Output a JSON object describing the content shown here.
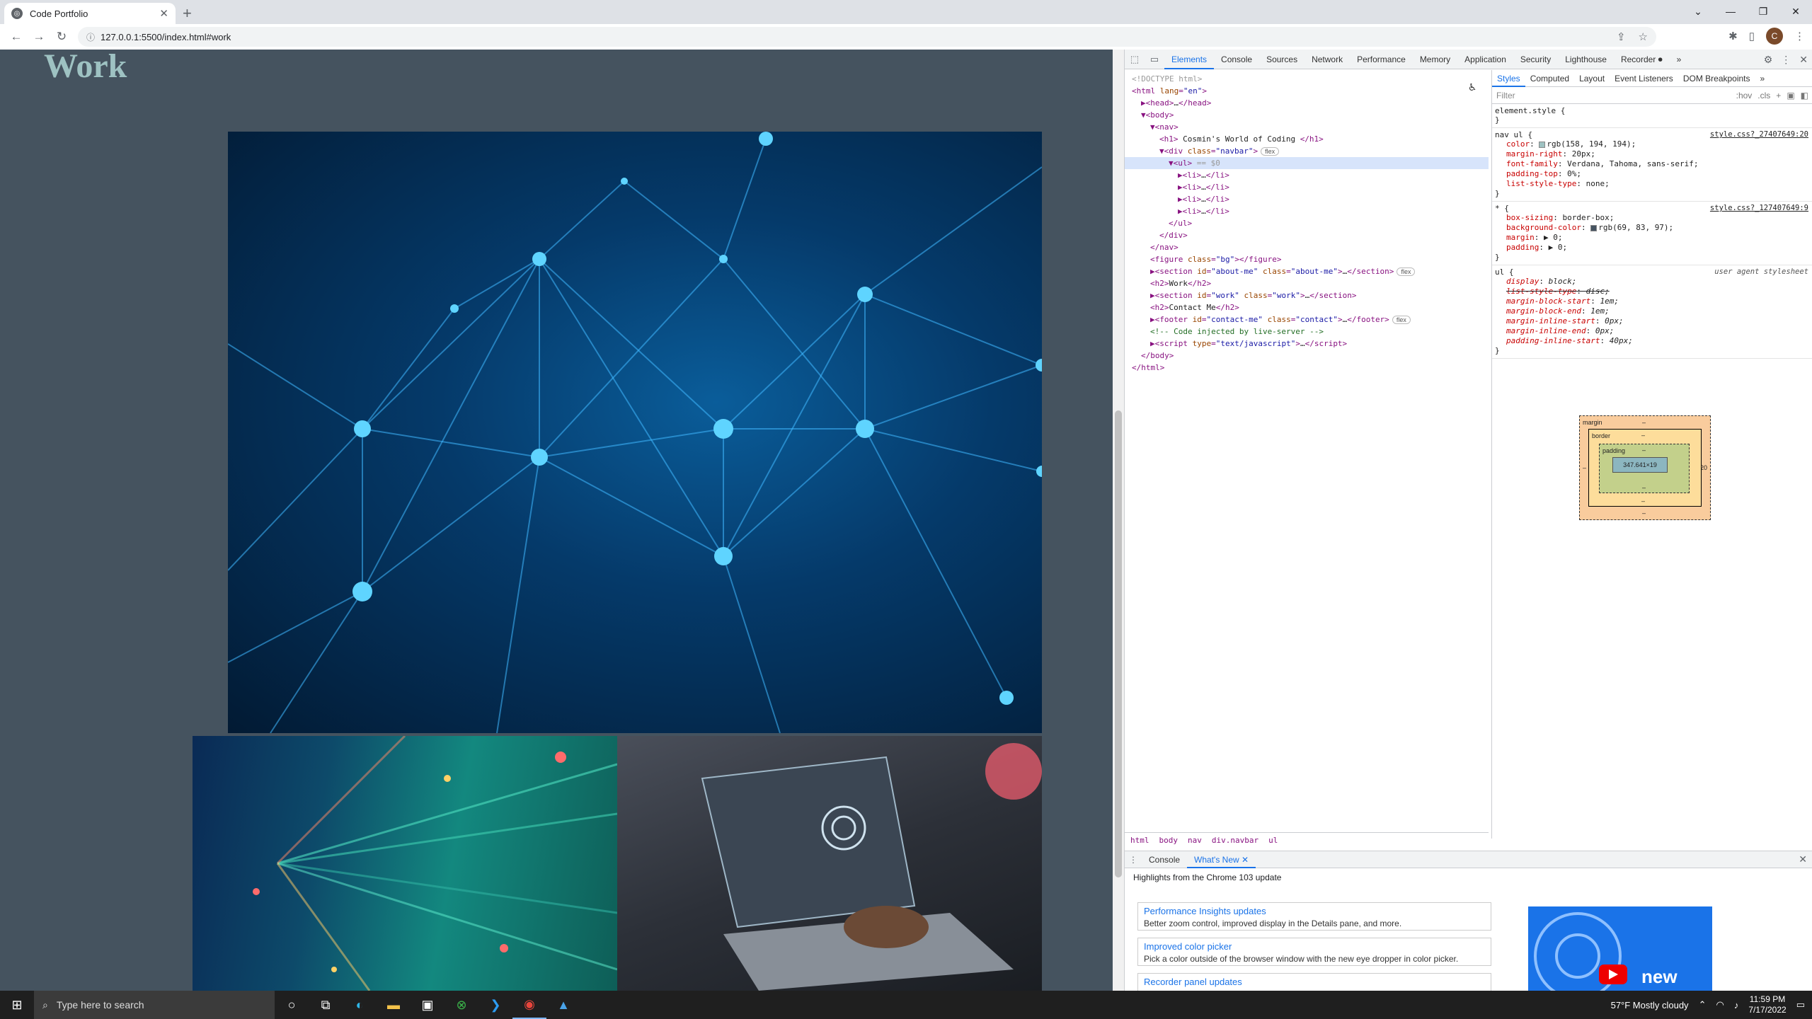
{
  "browser": {
    "tab_title": "Code Portfolio",
    "url": "127.0.0.1:5500/index.html#work",
    "profile_initial": "C"
  },
  "page": {
    "heading": "Work"
  },
  "devtools": {
    "tabs": [
      "Elements",
      "Console",
      "Sources",
      "Network",
      "Performance",
      "Memory",
      "Application",
      "Security",
      "Lighthouse",
      "Recorder ⏺",
      "»"
    ],
    "dom_lines": [
      {
        "indent": 0,
        "html": "<span class='dim'>&lt;!DOCTYPE html&gt;</span>"
      },
      {
        "indent": 0,
        "html": "<span class='tag'>&lt;html</span> <span class='atn'>lang</span>=<span class='atv'>\"en\"</span><span class='tag'>&gt;</span>"
      },
      {
        "indent": 1,
        "html": "▶<span class='tag'>&lt;head&gt;</span><span class='txt'>…</span><span class='tag'>&lt;/head&gt;</span>"
      },
      {
        "indent": 1,
        "html": "▼<span class='tag'>&lt;body&gt;</span>"
      },
      {
        "indent": 2,
        "html": "▼<span class='tag'>&lt;nav&gt;</span>"
      },
      {
        "indent": 3,
        "html": "<span class='tag'>&lt;h1&gt;</span><span class='txt'> Cosmin's World of Coding </span><span class='tag'>&lt;/h1&gt;</span>"
      },
      {
        "indent": 3,
        "html": "▼<span class='tag'>&lt;div</span> <span class='atn'>class</span>=<span class='atv'>\"navbar\"</span><span class='tag'>&gt;</span><span class='badge'>flex</span>"
      },
      {
        "indent": 4,
        "html": "▼<span class='tag'>&lt;ul&gt;</span><span class='dim'> == $0</span>",
        "sel": true
      },
      {
        "indent": 5,
        "html": "▶<span class='tag'>&lt;li&gt;</span><span class='txt'>…</span><span class='tag'>&lt;/li&gt;</span>"
      },
      {
        "indent": 5,
        "html": "▶<span class='tag'>&lt;li&gt;</span><span class='txt'>…</span><span class='tag'>&lt;/li&gt;</span>"
      },
      {
        "indent": 5,
        "html": "▶<span class='tag'>&lt;li&gt;</span><span class='txt'>…</span><span class='tag'>&lt;/li&gt;</span>"
      },
      {
        "indent": 5,
        "html": "▶<span class='tag'>&lt;li&gt;</span><span class='txt'>…</span><span class='tag'>&lt;/li&gt;</span>"
      },
      {
        "indent": 4,
        "html": "<span class='tag'>&lt;/ul&gt;</span>"
      },
      {
        "indent": 3,
        "html": "<span class='tag'>&lt;/div&gt;</span>"
      },
      {
        "indent": 2,
        "html": "<span class='tag'>&lt;/nav&gt;</span>"
      },
      {
        "indent": 2,
        "html": "<span class='tag'>&lt;figure</span> <span class='atn'>class</span>=<span class='atv'>\"bg\"</span><span class='tag'>&gt;&lt;/figure&gt;</span>"
      },
      {
        "indent": 2,
        "html": "▶<span class='tag'>&lt;section</span> <span class='atn'>id</span>=<span class='atv'>\"about-me\"</span> <span class='atn'>class</span>=<span class='atv'>\"about-me\"</span><span class='tag'>&gt;</span><span class='txt'>…</span><span class='tag'>&lt;/section&gt;</span><span class='badge'>flex</span>"
      },
      {
        "indent": 2,
        "html": "<span class='tag'>&lt;h2&gt;</span><span class='txt'>Work</span><span class='tag'>&lt;/h2&gt;</span>"
      },
      {
        "indent": 2,
        "html": "▶<span class='tag'>&lt;section</span> <span class='atn'>id</span>=<span class='atv'>\"work\"</span> <span class='atn'>class</span>=<span class='atv'>\"work\"</span><span class='tag'>&gt;</span><span class='txt'>…</span><span class='tag'>&lt;/section&gt;</span>"
      },
      {
        "indent": 2,
        "html": "<span class='tag'>&lt;h2&gt;</span><span class='txt'>Contact Me</span><span class='tag'>&lt;/h2&gt;</span>"
      },
      {
        "indent": 2,
        "html": "▶<span class='tag'>&lt;footer</span> <span class='atn'>id</span>=<span class='atv'>\"contact-me\"</span> <span class='atn'>class</span>=<span class='atv'>\"contact\"</span><span class='tag'>&gt;</span><span class='txt'>…</span><span class='tag'>&lt;/footer&gt;</span><span class='badge'>flex</span>"
      },
      {
        "indent": 2,
        "html": "<span class='cmt'>&lt;!-- Code injected by live-server --&gt;</span>"
      },
      {
        "indent": 2,
        "html": "▶<span class='tag'>&lt;script</span> <span class='atn'>type</span>=<span class='atv'>\"text/javascript\"</span><span class='tag'>&gt;</span><span class='txt'>…</span><span class='tag'>&lt;/script&gt;</span>"
      },
      {
        "indent": 1,
        "html": "<span class='tag'>&lt;/body&gt;</span>"
      },
      {
        "indent": 0,
        "html": "<span class='tag'>&lt;/html&gt;</span>"
      }
    ],
    "breadcrumbs": [
      "html",
      "body",
      "nav",
      "div.navbar",
      "ul"
    ],
    "style_tabs": [
      "Styles",
      "Computed",
      "Layout",
      "Event Listeners",
      "DOM Breakpoints",
      "»"
    ],
    "filter_placeholder": "Filter",
    "filter_hov": ":hov",
    "filter_cls": ".cls",
    "element_style": "element.style {",
    "rules": [
      {
        "selector": "nav ul {",
        "source": "style.css?_27407649:20",
        "ua": false,
        "props": [
          {
            "n": "color",
            "v": "rgb(158, 194, 194);",
            "swatch": "#9ec2c2"
          },
          {
            "n": "margin-right",
            "v": "20px;"
          },
          {
            "n": "font-family",
            "v": "Verdana, Tahoma, sans-serif;"
          },
          {
            "n": "padding-top",
            "v": "0%;"
          },
          {
            "n": "list-style-type",
            "v": "none;"
          }
        ]
      },
      {
        "selector": "* {",
        "source": "style.css?_127407649:9",
        "ua": false,
        "props": [
          {
            "n": "box-sizing",
            "v": "border-box;"
          },
          {
            "n": "background-color",
            "v": "rgb(69, 83, 97);",
            "swatch": "#455361"
          },
          {
            "n": "margin",
            "v": "▶ 0;"
          },
          {
            "n": "padding",
            "v": "▶ 0;"
          }
        ]
      },
      {
        "selector": "ul {",
        "source": "user agent stylesheet",
        "ua": true,
        "props": [
          {
            "n": "display",
            "v": "block;"
          },
          {
            "n": "list-style-type",
            "v": "disc;",
            "strike": true
          },
          {
            "n": "margin-block-start",
            "v": "1em;"
          },
          {
            "n": "margin-block-end",
            "v": "1em;"
          },
          {
            "n": "margin-inline-start",
            "v": "0px;"
          },
          {
            "n": "margin-inline-end",
            "v": "0px;"
          },
          {
            "n": "padding-inline-start",
            "v": "40px;"
          }
        ]
      }
    ],
    "box_model": {
      "margin_label": "margin",
      "border_label": "border",
      "padding_label": "padding",
      "content": "347.641×19",
      "dash": "–",
      "right_value": "20"
    },
    "drawer": {
      "tabs": [
        "Console",
        "What's New"
      ],
      "highlights": "Highlights from the Chrome 103 update",
      "cards": [
        {
          "title": "Performance Insights updates",
          "desc": "Better zoom control, improved display in the Details pane, and more."
        },
        {
          "title": "Improved color picker",
          "desc": "Pick a color outside of the browser window with the new eye dropper in color picker."
        },
        {
          "title": "Recorder panel updates",
          "desc": ""
        }
      ],
      "video_text": "new"
    }
  },
  "taskbar": {
    "search_placeholder": "Type here to search",
    "weather": "57°F  Mostly cloudy",
    "time": "11:59 PM",
    "date": "7/17/2022"
  }
}
